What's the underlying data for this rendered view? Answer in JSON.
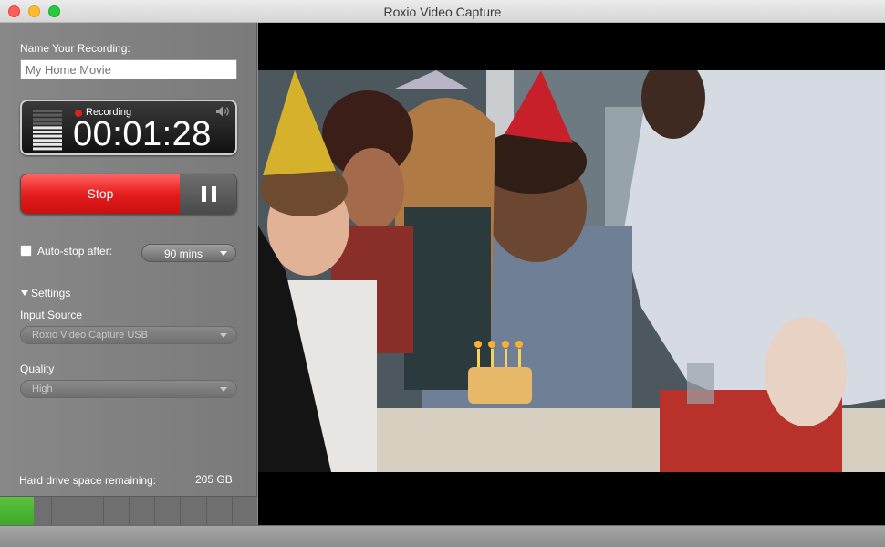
{
  "window": {
    "title": "Roxio Video Capture"
  },
  "recording": {
    "name_label": "Name Your Recording:",
    "name_placeholder": "My Home Movie",
    "status_label": "Recording",
    "elapsed": "00:01:28",
    "level_fraction": 0.6
  },
  "controls": {
    "stop_label": "Stop"
  },
  "autostop": {
    "label": "Auto-stop after:",
    "value": "90 mins",
    "checked": false
  },
  "settings": {
    "header": "Settings",
    "input_source_label": "Input Source",
    "input_source_value": "Roxio Video Capture USB",
    "quality_label": "Quality",
    "quality_value": "High"
  },
  "disk": {
    "label": "Hard drive space remaining:",
    "value": "205 GB",
    "used_fraction": 0.13
  },
  "colors": {
    "stop_red": "#e51c1c",
    "disk_green": "#3fa82a",
    "rec_dot": "#e02020"
  }
}
